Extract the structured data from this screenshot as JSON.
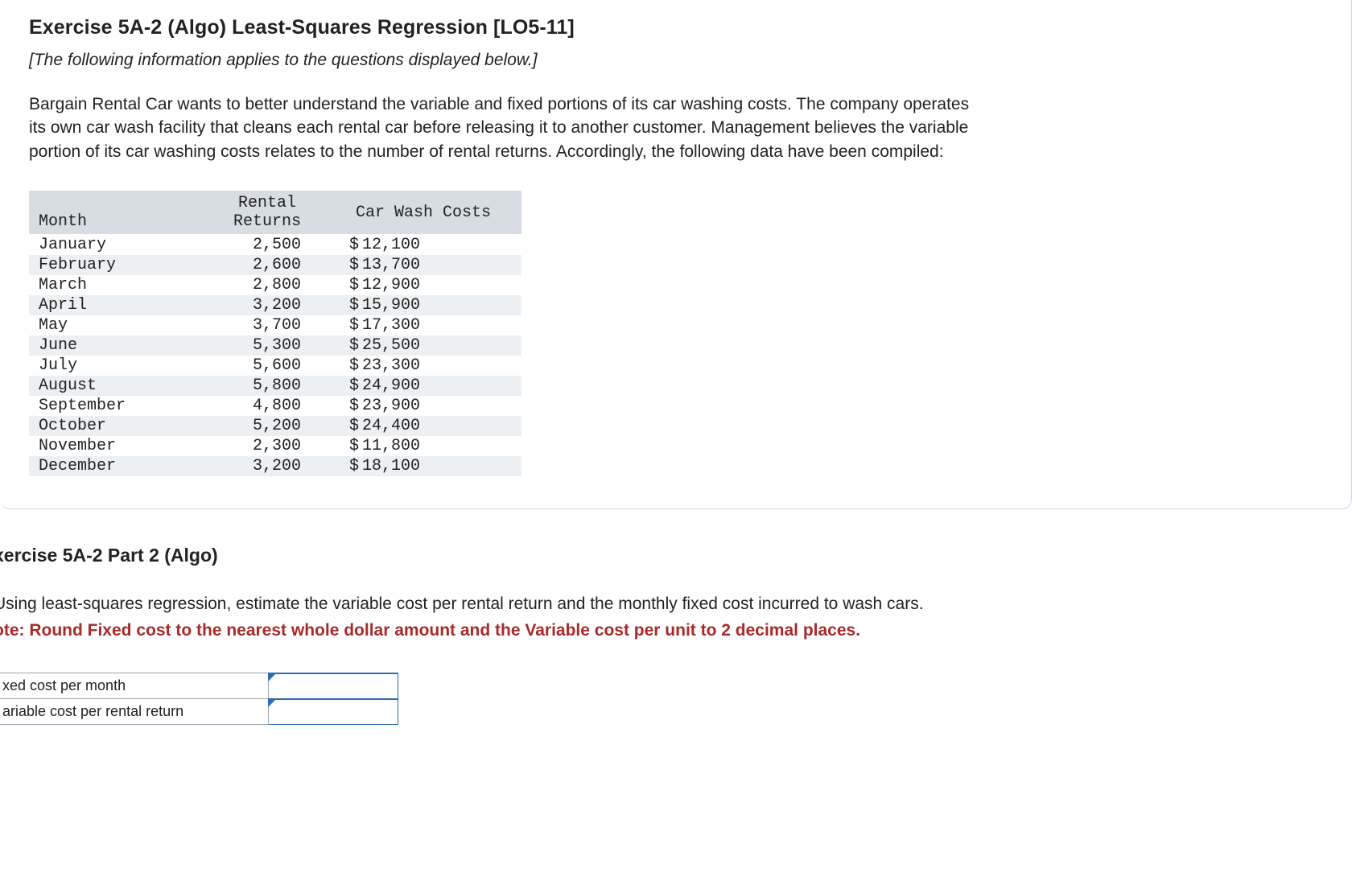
{
  "exercise": {
    "title": "Exercise 5A-2 (Algo) Least-Squares Regression [LO5-11]",
    "subtitle": "[The following information applies to the questions displayed below.]",
    "body": "Bargain Rental Car wants to better understand the variable and fixed portions of its car washing costs. The company operates its own car wash facility that cleans each rental car before releasing it to another customer. Management believes the variable portion of its car washing costs relates to the number of rental returns. Accordingly, the following data have been compiled:"
  },
  "table": {
    "headers": {
      "month": "Month",
      "returns": "Rental\nReturns",
      "costs": "Car Wash Costs"
    },
    "rows": [
      {
        "month": "January",
        "returns": "2,500",
        "cost": "12,100"
      },
      {
        "month": "February",
        "returns": "2,600",
        "cost": "13,700"
      },
      {
        "month": "March",
        "returns": "2,800",
        "cost": "12,900"
      },
      {
        "month": "April",
        "returns": "3,200",
        "cost": "15,900"
      },
      {
        "month": "May",
        "returns": "3,700",
        "cost": "17,300"
      },
      {
        "month": "June",
        "returns": "5,300",
        "cost": "25,500"
      },
      {
        "month": "July",
        "returns": "5,600",
        "cost": "23,300"
      },
      {
        "month": "August",
        "returns": "5,800",
        "cost": "24,900"
      },
      {
        "month": "September",
        "returns": "4,800",
        "cost": "23,900"
      },
      {
        "month": "October",
        "returns": "5,200",
        "cost": "24,400"
      },
      {
        "month": "November",
        "returns": "2,300",
        "cost": "11,800"
      },
      {
        "month": "December",
        "returns": "3,200",
        "cost": "18,100"
      }
    ],
    "currency": "$"
  },
  "part2": {
    "title": "xercise 5A-2 Part 2 (Algo)",
    "question": "Using least-squares regression, estimate the variable cost per rental return and the monthly fixed cost incurred to wash cars.",
    "note": "ote: Round Fixed cost to the nearest whole dollar amount and the Variable cost per unit to 2 decimal places."
  },
  "answers": {
    "fixed_label": "xed cost per month",
    "variable_label": "ariable cost per rental return",
    "fixed_value": "",
    "variable_value": ""
  }
}
